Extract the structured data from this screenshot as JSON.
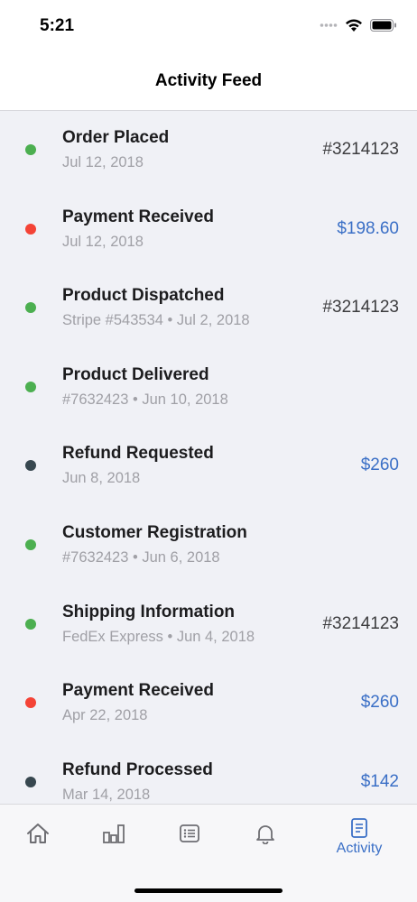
{
  "status_bar": {
    "time": "5:21"
  },
  "header": {
    "title": "Activity Feed"
  },
  "colors": {
    "green": "#4caf50",
    "red": "#f44336",
    "dark": "#37474f",
    "accent": "#3a6fc6",
    "neutral": "#3c3c3e"
  },
  "feed": [
    {
      "title": "Order Placed",
      "subtitle": "Jul 12, 2018",
      "value": "#3214123",
      "status": "green",
      "value_style": "neutral"
    },
    {
      "title": "Payment Received",
      "subtitle": "Jul 12, 2018",
      "value": "$198.60",
      "status": "red",
      "value_style": "accent"
    },
    {
      "title": "Product Dispatched",
      "subtitle": "Stripe #543534 • Jul 2, 2018",
      "value": "#3214123",
      "status": "green",
      "value_style": "neutral"
    },
    {
      "title": "Product Delivered",
      "subtitle": "#7632423 • Jun 10, 2018",
      "value": "",
      "status": "green",
      "value_style": "neutral"
    },
    {
      "title": "Refund Requested",
      "subtitle": "Jun 8, 2018",
      "value": "$260",
      "status": "dark",
      "value_style": "accent"
    },
    {
      "title": "Customer Registration",
      "subtitle": "#7632423 • Jun 6, 2018",
      "value": "",
      "status": "green",
      "value_style": "neutral"
    },
    {
      "title": "Shipping Information",
      "subtitle": "FedEx Express • Jun 4, 2018",
      "value": "#3214123",
      "status": "green",
      "value_style": "neutral"
    },
    {
      "title": "Payment Received",
      "subtitle": "Apr 22, 2018",
      "value": "$260",
      "status": "red",
      "value_style": "accent"
    },
    {
      "title": "Refund Processed",
      "subtitle": "Mar 14, 2018",
      "value": "$142",
      "status": "dark",
      "value_style": "accent"
    }
  ],
  "tab_bar": {
    "tabs": [
      {
        "icon": "home-icon",
        "label": ""
      },
      {
        "icon": "bar-chart-icon",
        "label": ""
      },
      {
        "icon": "list-icon",
        "label": ""
      },
      {
        "icon": "bell-icon",
        "label": ""
      },
      {
        "icon": "activity-document-icon",
        "label": "Activity",
        "active": true
      }
    ]
  }
}
